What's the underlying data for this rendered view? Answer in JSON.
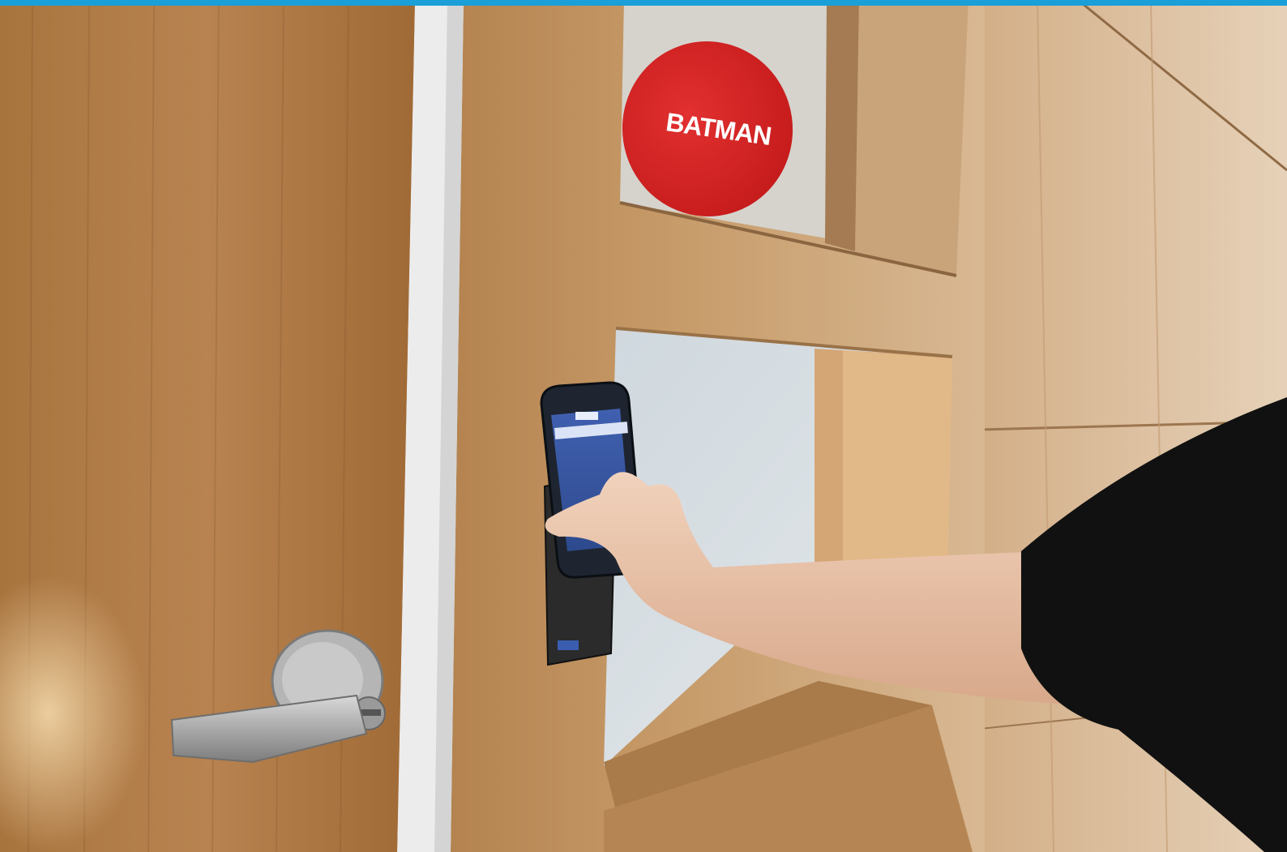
{
  "sign": {
    "text": "BATMAN",
    "color": "#d82424"
  },
  "accent_bar_color": "#1a9fd8",
  "objects": {
    "door_icon": "door",
    "lever_icon": "door-lever-handle",
    "reader_icon": "access-card-reader",
    "phone_icon": "smartphone",
    "arm_icon": "arm-hand"
  }
}
